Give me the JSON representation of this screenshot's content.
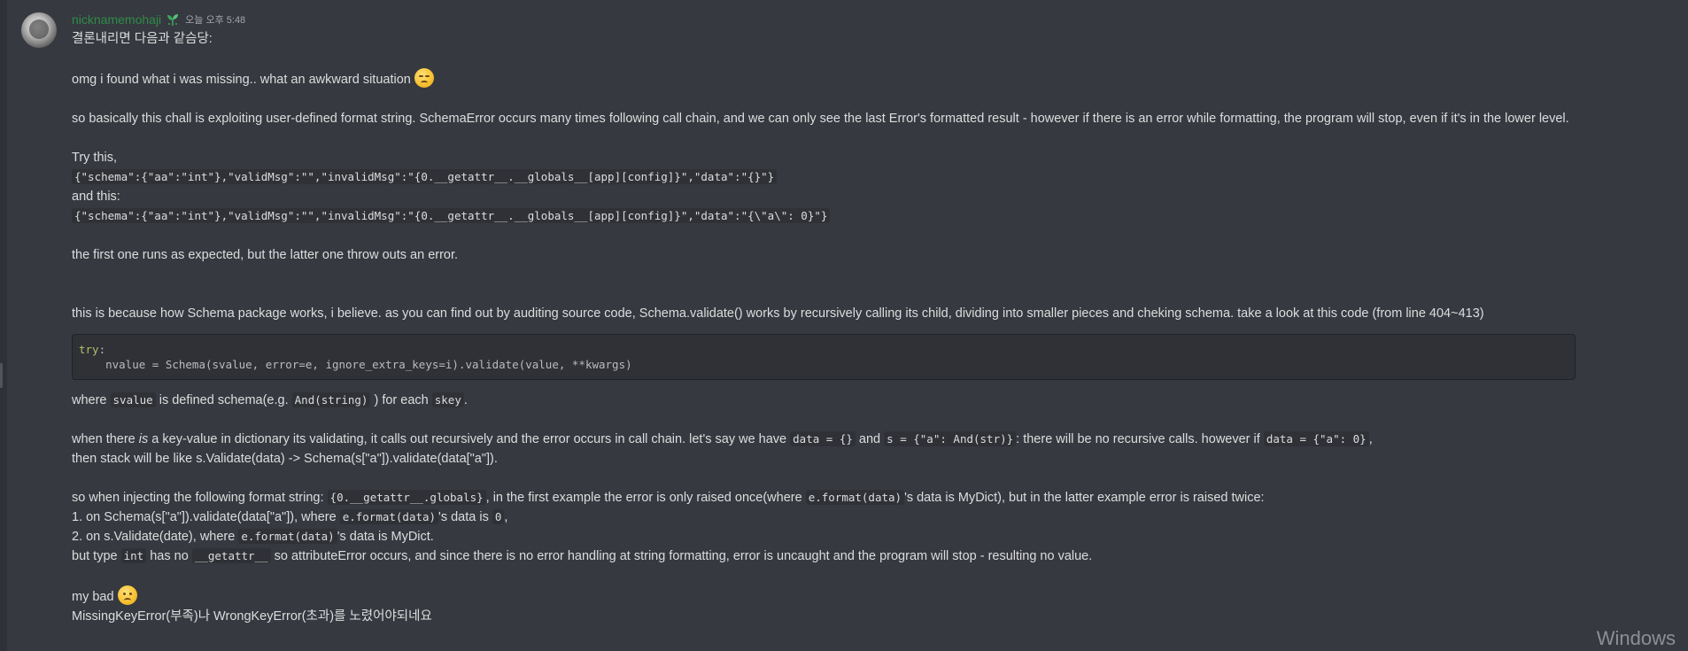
{
  "message": {
    "username": "nicknamemohaji",
    "timestamp": "오늘 오후 5:48",
    "lines": {
      "conclusion": "결론내리면 다음과 같슴당:",
      "omg": "omg i found what i was missing.. what an awkward situation",
      "explain": "so basically this chall is exploiting user-defined format string. SchemaError occurs many times following call chain, and we can only see the last Error's formatted result - however if there is an error while formatting, the program will stop, even if it's in the lower level.",
      "try_this": "Try this,",
      "payload1": "{\"schema\":{\"aa\":\"int\"},\"validMsg\":\"\",\"invalidMsg\":\"{0.__getattr__.__globals__[app][config]}\",\"data\":\"{}\"}",
      "and_this": "and this:",
      "payload2": "{\"schema\":{\"aa\":\"int\"},\"validMsg\":\"\",\"invalidMsg\":\"{0.__getattr__.__globals__[app][config]}\",\"data\":\"{\\\"a\\\": 0}\"}",
      "first_one": "the first one runs as expected, but the latter one throw outs an error.",
      "because": "this is because how Schema package works, i believe. as you can find out by auditing source code, Schema.validate() works by recursively calling its child, dividing into smaller pieces and cheking schema. take a look at this code (from line 404~413)",
      "code_try": "try",
      "code_colon": ":",
      "code_line2": "    nvalue = Schema(svalue, error=e, ignore_extra_keys=i).validate(value, **kwargs)",
      "where_1": "where",
      "where_code1": "svalue",
      "where_2": "is defined schema(e.g.",
      "where_code2": "And(string)",
      "where_3": ") for each",
      "where_code3": "skey",
      "where_4": ".",
      "when_1": "when there",
      "when_is": "is",
      "when_2": "a key-value in dictionary its validating, it calls out recursively and the error occurs in call chain. let's say we have",
      "when_code1": "data = {}",
      "when_3": "and",
      "when_code2": "s = {\"a\": And(str)}",
      "when_4": ": there will be no recursive calls. however if",
      "when_code3": "data = {\"a\": 0}",
      "when_5": ",",
      "stack": "then stack will be like s.Validate(data) -> Schema(s[\"a\"]).validate(data[\"a\"]).",
      "inject_1": "so when injecting the following format string:",
      "inject_code1": "{0.__getattr__.globals}",
      "inject_2": ", in the first example the error is only raised once(where",
      "inject_code2": "e.format(data)",
      "inject_3": "'s data is MyDict), but in the latter example error is raised twice:",
      "list1_1": "1. on  Schema(s[\"a\"]).validate(data[\"a\"]), where",
      "list1_code1": "e.format(data)",
      "list1_2": "'s data is",
      "list1_code2": "0",
      "list1_3": ",",
      "list2_1": "2. on s.Validate(date), where",
      "list2_code1": "e.format(data)",
      "list2_2": "'s data is MyDict.",
      "but_1": "but type",
      "but_code1": "int",
      "but_2": "has no",
      "but_code2": "__getattr__",
      "but_3": "so attributeError occurs, and since there is no error handling at string formatting, error is uncaught and the program will stop - resulting no value.",
      "my_bad": "my bad",
      "missing": "MissingKeyError(부족)나 WrongKeyError(초과)를 노렸어야되네요"
    }
  },
  "watermark": "Windows",
  "colors": {
    "background": "#36393f",
    "username": "#2e8c4a",
    "text": "#dcddde",
    "code_bg": "#2f3136"
  },
  "icons": {
    "badge": "sprout-badge-icon",
    "emoji1": "relieved-face-emoji",
    "emoji2": "slightly-frowning-face-emoji"
  }
}
